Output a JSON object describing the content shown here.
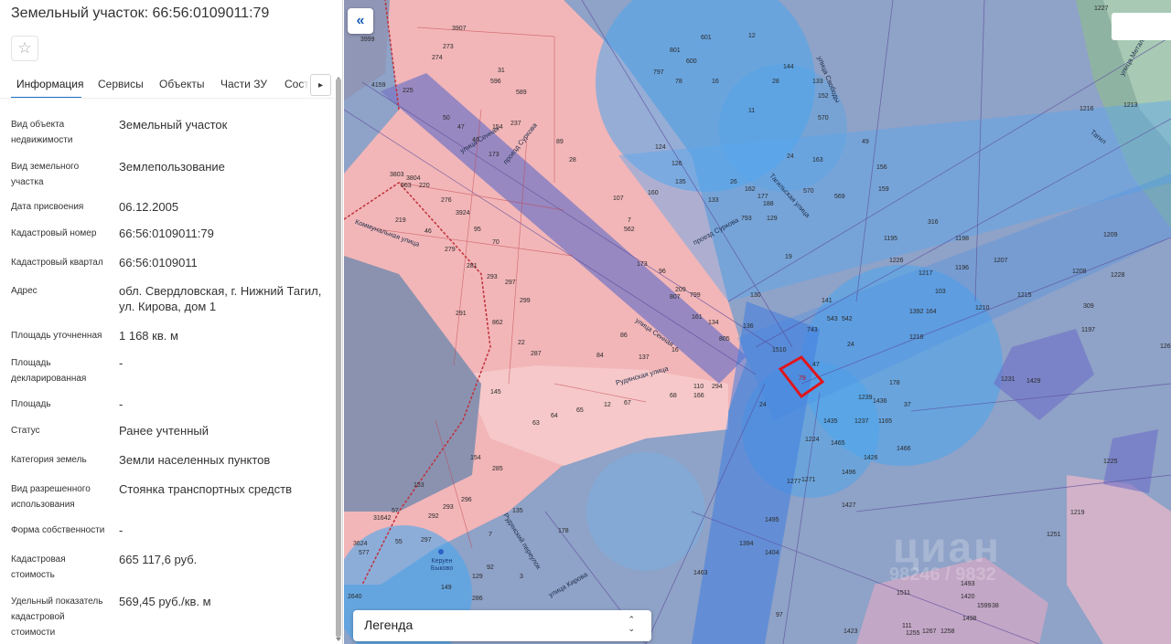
{
  "panel": {
    "title": "Земельный участок: 66:56:0109011:79",
    "favorite_icon": "star-outline-icon",
    "tabs": [
      {
        "label": "Информация",
        "active": true
      },
      {
        "label": "Сервисы",
        "active": false
      },
      {
        "label": "Объекты",
        "active": false
      },
      {
        "label": "Части ЗУ",
        "active": false
      },
      {
        "label": "Состав",
        "active": false
      }
    ],
    "tab_next_icon": "chevron-right-icon",
    "rows": [
      {
        "label": "Вид объекта недвижимости",
        "value": "Земельный участок"
      },
      {
        "label": "Вид земельного участка",
        "value": "Землепользование"
      },
      {
        "label": "Дата присвоения",
        "value": "06.12.2005"
      },
      {
        "label": "Кадастровый номер",
        "value": "66:56:0109011:79"
      },
      {
        "label": "Кадастровый квартал",
        "value": "66:56:0109011"
      },
      {
        "label": "Адрес",
        "value": "обл. Свердловская, г. Нижний Тагил, ул. Кирова, дом 1"
      },
      {
        "label": "Площадь уточненная",
        "value": "1 168 кв. м"
      },
      {
        "label": "Площадь декларированная",
        "value": "-"
      },
      {
        "label": "Площадь",
        "value": "-"
      },
      {
        "label": "Статус",
        "value": "Ранее учтенный"
      },
      {
        "label": "Категория земель",
        "value": "Земли населенных пунктов"
      },
      {
        "label": "Вид разрешенного использования",
        "value": "Стоянка транспортных средств"
      },
      {
        "label": "Форма собственности",
        "value": "-"
      },
      {
        "label": "Кадастровая стоимость",
        "value": "665 117,6 руб."
      },
      {
        "label": "Удельный показатель кадастровой стоимости",
        "value": "569,45 руб./кв. м"
      }
    ]
  },
  "map": {
    "collapse_icon": "double-chevron-left-icon",
    "legend_label": "Легенда",
    "legend_icon": "up-down-chevron-icon",
    "selected_parcel_label": "79",
    "poi_label": "Керуен Быково",
    "watermark": "циан",
    "watermark_sub": "98246 / 9832",
    "streets": [
      "улица Сенная",
      "улица Сенная",
      "Коммунальная улица",
      "Рудянская улица",
      "улица Кирова",
      "Рудянский переулок",
      "Тагильская улица",
      "проезд Суркова",
      "проезд Суркова",
      "улица Свободы",
      "улица Металлургов",
      "Тагил"
    ],
    "parcel_numbers": [
      "3999",
      "3907",
      "273",
      "274",
      "4159",
      "225",
      "31",
      "596",
      "589",
      "50",
      "47",
      "154",
      "237",
      "46",
      "173",
      "89",
      "28",
      "3803",
      "3804",
      "963",
      "220",
      "276",
      "3924",
      "219",
      "95",
      "46",
      "279",
      "281",
      "70",
      "291",
      "293",
      "297",
      "299",
      "862",
      "22",
      "287",
      "84",
      "86",
      "137",
      "16",
      "145",
      "63",
      "64",
      "65",
      "12",
      "67",
      "68",
      "110",
      "166",
      "294",
      "24",
      "154",
      "285",
      "153",
      "57",
      "31642",
      "292",
      "293",
      "296",
      "55",
      "297",
      "3624",
      "577",
      "135",
      "7",
      "178",
      "129",
      "92",
      "3",
      "149",
      "286",
      "2640",
      "801",
      "600",
      "601",
      "797",
      "78",
      "16",
      "11",
      "12",
      "28",
      "144",
      "133",
      "152",
      "570",
      "24",
      "570",
      "163",
      "569",
      "49",
      "156",
      "159",
      "26",
      "162",
      "177",
      "188",
      "129",
      "793",
      "133",
      "135",
      "126",
      "160",
      "124",
      "107",
      "562",
      "7",
      "173",
      "96",
      "209",
      "807",
      "799",
      "161",
      "130",
      "134",
      "805",
      "136",
      "19",
      "141",
      "543",
      "542",
      "743",
      "24",
      "1510",
      "47",
      "178",
      "1239",
      "1436",
      "37",
      "1435",
      "1237",
      "1165",
      "1224",
      "1465",
      "1426",
      "1466",
      "1496",
      "1271",
      "1427",
      "1277",
      "1495",
      "1394",
      "1463",
      "1404",
      "97",
      "1511",
      "1493",
      "1420",
      "1599",
      "38",
      "111",
      "1267",
      "1258",
      "1498",
      "1255",
      "1423",
      "1219",
      "1251",
      "1225",
      "1429",
      "1231",
      "309",
      "1197",
      "1208",
      "1207",
      "1196",
      "1209",
      "1228",
      "1227",
      "1198",
      "1215",
      "1210",
      "1216",
      "1213",
      "1262",
      "1218",
      "1195",
      "1226",
      "1217",
      "316",
      "103",
      "1392",
      "164",
      "155",
      "26",
      "27",
      "44",
      "7",
      "2",
      "3"
    ]
  },
  "colors": {
    "map_base": "#97a6c4",
    "parcel_pink": "#f2b6b8",
    "buffer_blue": "#4aa6ee",
    "road_purple": "#7a78c4",
    "selected_outline": "#e0151b",
    "tab_accent": "#1a73c9"
  }
}
